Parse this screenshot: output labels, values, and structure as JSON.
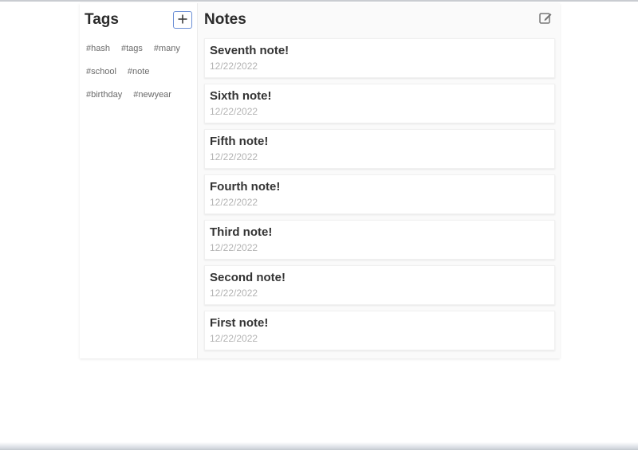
{
  "tags_panel": {
    "title": "Tags",
    "add_icon": "plus-icon",
    "tags": [
      "#hash",
      "#tags",
      "#many",
      "#school",
      "#note",
      "#birthday",
      "#newyear"
    ]
  },
  "notes_panel": {
    "title": "Notes",
    "compose_icon": "edit-icon",
    "notes": [
      {
        "title": "Seventh note!",
        "date": "12/22/2022"
      },
      {
        "title": "Sixth note!",
        "date": "12/22/2022"
      },
      {
        "title": "Fifth note!",
        "date": "12/22/2022"
      },
      {
        "title": "Fourth note!",
        "date": "12/22/2022"
      },
      {
        "title": "Third note!",
        "date": "12/22/2022"
      },
      {
        "title": "Second note!",
        "date": "12/22/2022"
      },
      {
        "title": "First note!",
        "date": "12/22/2022"
      }
    ]
  },
  "colors": {
    "accent": "#6b8fd6",
    "muted_text": "#b3b3b3"
  }
}
